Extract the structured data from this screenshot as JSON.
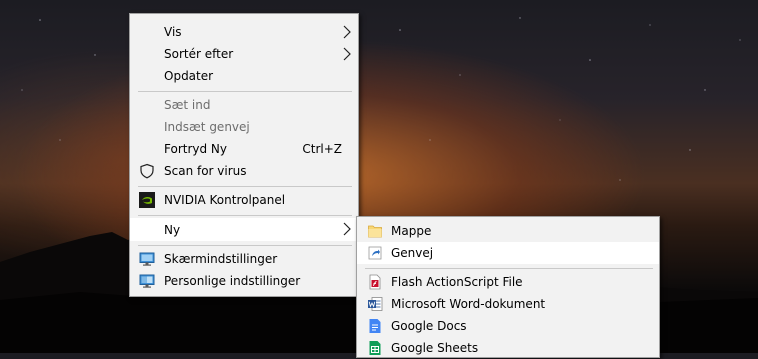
{
  "context_menu": {
    "items": [
      {
        "label": "Vis"
      },
      {
        "label": "Sortér efter"
      },
      {
        "label": "Opdater"
      },
      {
        "label": "Sæt ind"
      },
      {
        "label": "Indsæt genvej"
      },
      {
        "label": "Fortryd Ny",
        "shortcut": "Ctrl+Z"
      },
      {
        "label": "Scan for virus",
        "icon": "shield-icon"
      },
      {
        "label": "NVIDIA Kontrolpanel",
        "icon": "nvidia-icon"
      },
      {
        "label": "Ny"
      },
      {
        "label": "Skærmindstillinger",
        "icon": "display-icon"
      },
      {
        "label": "Personlige indstillinger",
        "icon": "personalize-icon"
      }
    ]
  },
  "submenu_new": {
    "items": [
      {
        "label": "Mappe",
        "icon": "folder-icon"
      },
      {
        "label": "Genvej",
        "icon": "shortcut-icon"
      },
      {
        "label": "Flash ActionScript File",
        "icon": "flash-file-icon"
      },
      {
        "label": "Microsoft Word-dokument",
        "icon": "word-icon"
      },
      {
        "label": "Google Docs",
        "icon": "google-docs-icon"
      },
      {
        "label": "Google Sheets",
        "icon": "google-sheets-icon"
      }
    ]
  },
  "colors": {
    "menu_bg": "#f2f2f2",
    "highlight": "#ffffff",
    "disabled_text": "#6d6d6d",
    "nvidia_green": "#76b900",
    "google_docs_blue": "#4285f4",
    "google_sheets_green": "#0f9d58",
    "word_blue": "#2b579a"
  }
}
